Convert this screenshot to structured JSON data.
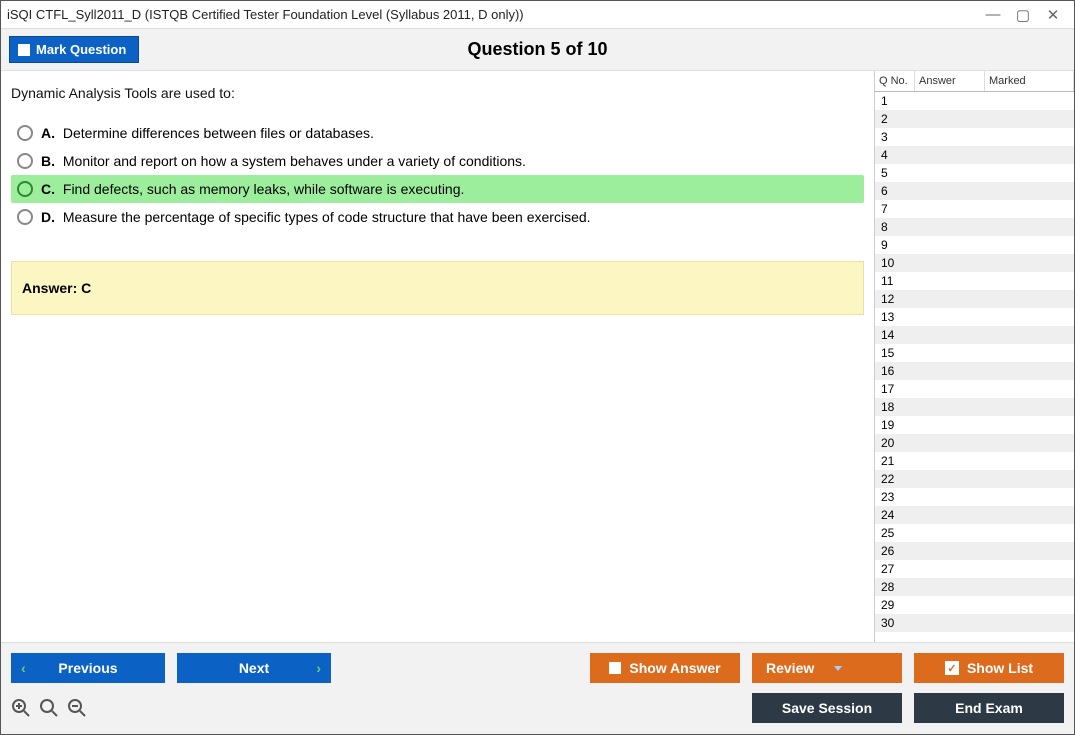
{
  "window": {
    "title": "iSQI CTFL_Syll2011_D (ISTQB Certified Tester Foundation Level (Syllabus 2011, D only))"
  },
  "header": {
    "mark_label": "Mark Question",
    "question_title": "Question 5 of 10"
  },
  "question": {
    "text": "Dynamic Analysis Tools are used to:",
    "options": [
      {
        "letter": "A.",
        "text": "Determine differences between files or databases.",
        "selected": false
      },
      {
        "letter": "B.",
        "text": "Monitor and report on how a system behaves under a variety of conditions.",
        "selected": false
      },
      {
        "letter": "C.",
        "text": "Find defects, such as memory leaks, while software is executing.",
        "selected": true
      },
      {
        "letter": "D.",
        "text": "Measure the percentage of specific types of code structure that have been exercised.",
        "selected": false
      }
    ],
    "answer_label": "Answer: C"
  },
  "qlist": {
    "head_qno": "Q No.",
    "head_ans": "Answer",
    "head_mrk": "Marked",
    "count": 30
  },
  "footer": {
    "previous": "Previous",
    "next": "Next",
    "show_answer": "Show Answer",
    "review": "Review",
    "show_list": "Show List",
    "save_session": "Save Session",
    "end_exam": "End Exam"
  }
}
